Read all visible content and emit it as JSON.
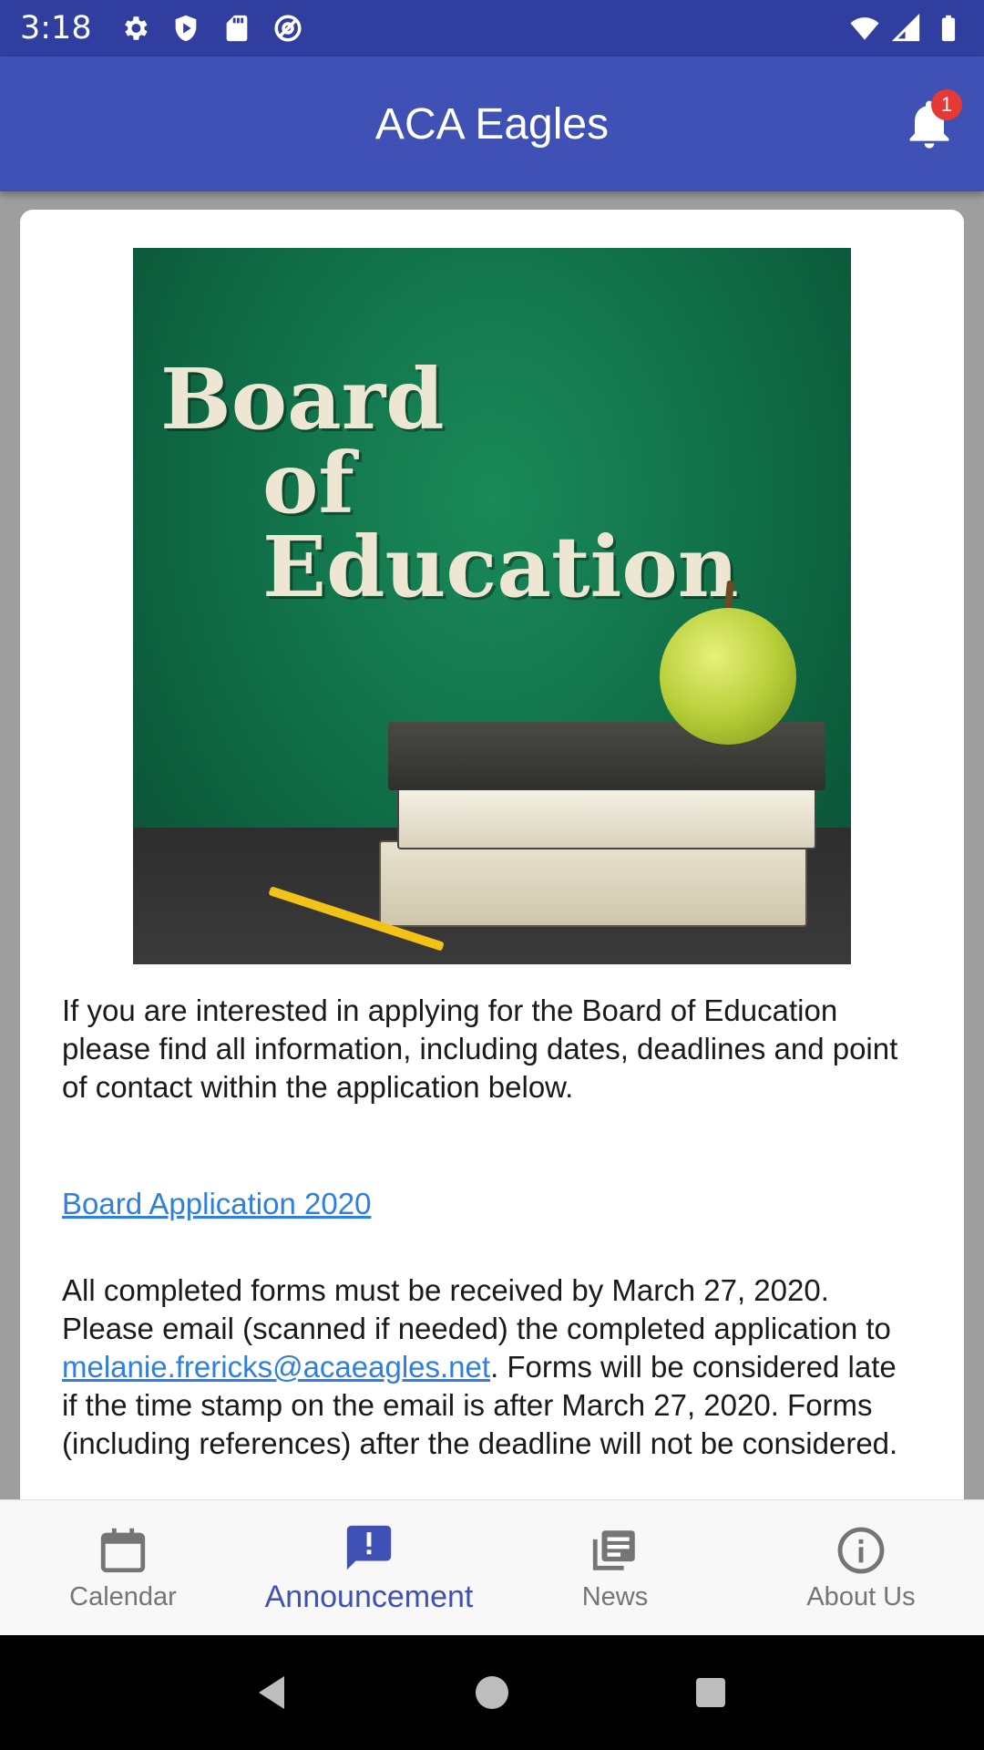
{
  "status_bar": {
    "time": "3:18",
    "left_icons": [
      "gear-icon",
      "shield-play-icon",
      "sd-card-icon",
      "at-sign-icon"
    ],
    "right_icons": [
      "wifi-icon",
      "cell-signal-icon",
      "battery-icon"
    ]
  },
  "app_bar": {
    "title": "ACA Eagles",
    "notification_count": "1",
    "bg_color": "#3f51b5"
  },
  "announcement": {
    "hero_image_text_line1": "Board",
    "hero_image_text_line2": "of Education",
    "paragraph1": "If you are interested in applying for the Board of Education please find all information, including dates, deadlines and point of contact within the application below.",
    "link_text": "Board Application 2020",
    "paragraph3_before": "All completed forms must be received by March 27, 2020.  Please email (scanned if needed) the completed application to ",
    "email_link": "melanie.frericks@acaeagles.net",
    "paragraph3_after": ".  Forms will be considered late if the time stamp on the email is after March 27, 2020. Forms (including references) after the deadline will not be considered."
  },
  "bottom_nav": {
    "items": [
      {
        "label": "Calendar",
        "icon": "calendar-icon",
        "active": false
      },
      {
        "label": "Announcement",
        "icon": "announcement-icon",
        "active": true
      },
      {
        "label": "News",
        "icon": "news-icon",
        "active": false
      },
      {
        "label": "About Us",
        "icon": "info-icon",
        "active": false
      }
    ]
  },
  "system_nav": {
    "buttons": [
      "back-icon",
      "home-icon",
      "recents-icon"
    ]
  }
}
